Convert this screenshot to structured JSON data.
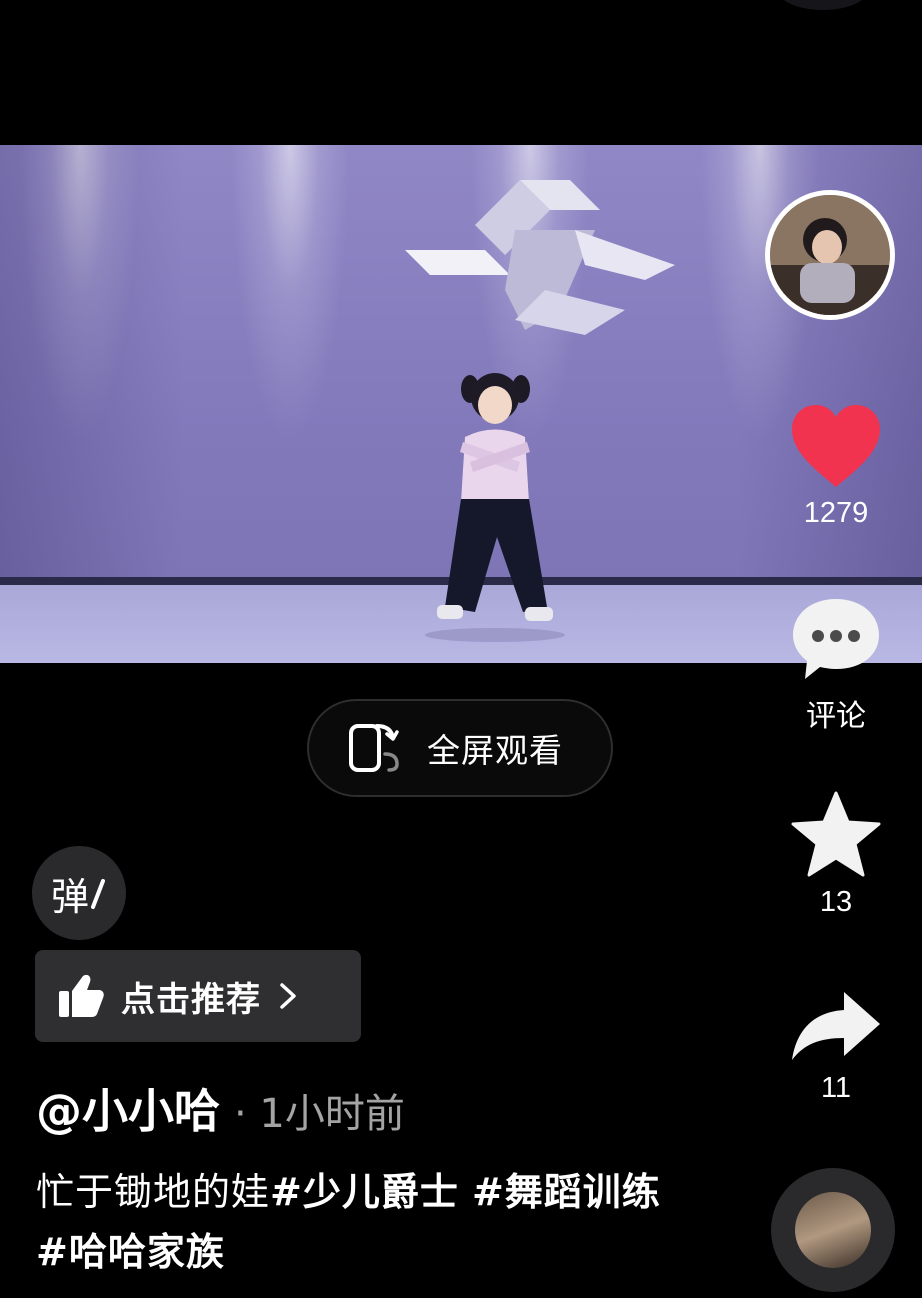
{
  "video": {
    "fullscreen_label": "全屏观看"
  },
  "rail": {
    "like_count": "1279",
    "comment_label": "评论",
    "favorite_count": "13",
    "share_count": "11"
  },
  "danmu_label": "弹",
  "recommend_label": "点击推荐",
  "post": {
    "author": "@小小哈",
    "time": "· 1小时前",
    "caption_text": "忙于锄地的娃",
    "tags": [
      "#少儿爵士",
      "#舞蹈训练",
      "#哈哈家族"
    ]
  },
  "colors": {
    "like": "#f2334f",
    "background": "#000000"
  }
}
